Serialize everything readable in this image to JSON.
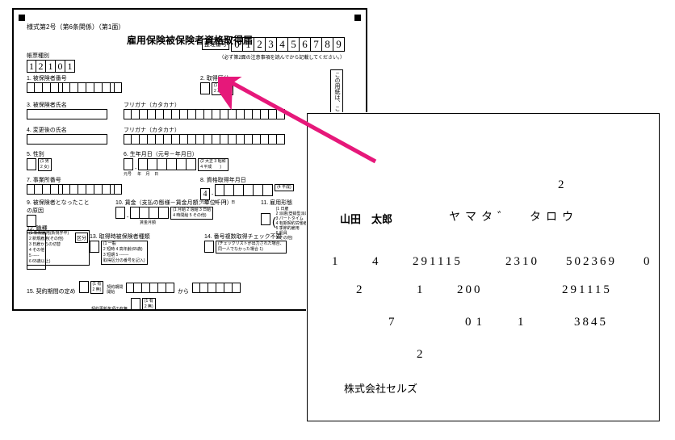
{
  "form": {
    "header": "様式第2号（第6条関係）（第1面）",
    "title": "雇用保険被保険者資格取得届",
    "seibango_label": "整理番号",
    "seibango_digits": [
      "0",
      "1",
      "2",
      "3",
      "4",
      "5",
      "6",
      "7",
      "8",
      "9"
    ],
    "note": "（必ず第2面の注意事項を読んでから記載してください。）",
    "chohyo_label": "帳票種別",
    "chohyo_value": [
      "1",
      "2",
      "1",
      "0",
      "1"
    ],
    "sec1": "1. 被保険者番号",
    "sec2": "2. 取得区分",
    "sec2_legend": "(1 新規\n2 再取得)",
    "sec3": "3. 被保険者氏名",
    "furigana": "フリガナ（カタカナ）",
    "sec4": "4. 変更後の氏名",
    "sec5": "5. 性別",
    "sec5_legend": "(1 男\n2 女)",
    "sec6": "6. 生年月日（元号－年月日）",
    "sec6_legend": "(2 大正 3 昭和\n4 平成　　)",
    "sec6_sub1": "元号",
    "sec6_sub2": "年",
    "sec6_sub3": "月",
    "sec6_sub4": "日",
    "sec7": "7. 事業所番号",
    "sec8": "8. 資格取得年月日",
    "sec8_legend": "(4 平成)",
    "sec9": "9. 被保険者となったこと\nの原因",
    "sec9_legend": "(1 新規雇用(新規学卒)\n2 新規雇用(その他)\n3 日雇からの切替\n4 その他\n5 -----\n6 65歳以上)",
    "sec10": "10. 賃金（支払の態様－賃金月額：単位千円）",
    "sec10_legend": "(1 月給 2 週給 3 日給\n4 時間給 5 その他)",
    "sec10_sub": "賃金月額",
    "sec11": "11. 雇用形態",
    "sec11_legend": "(1 日雇\n2 派遣(登録型派遣)\n3 パートタイム\n4 有期契約労働者\n5 季節的雇用\n6 船員\n7 その他)",
    "sec12": "12. 職種",
    "sec13": "13. 取得時被保険者種類",
    "sec13_box": "区分",
    "sec13_legend": "(1 一般\n2 短時 4 高年齢(65歳)\n3 短期 5 -------\n取得区分の番号を記入)",
    "sec14": "14. 番号複数取得チェック不要",
    "sec14_legend": "(チェックリストが出力された場合、\n同一人でなかった場合 1)",
    "sec15": "15. 契約期間の定め",
    "sec15_legend": "(1 有\n2 無)",
    "sec15b": "契約期間\n開始",
    "sec15_kara": "から",
    "sec15c": "契約更新条項の有無",
    "sec15c_legend": "(1 有\n2 無)",
    "vnote": "この用紙は、このまま機械"
  },
  "paper": {
    "val_top": "2",
    "name": "山田　太郎",
    "kana": "ヤマタ゛　タロウ",
    "r1a": "1",
    "r1b": "4",
    "r1c": "291115",
    "r1d": "2310",
    "r1e": "502369",
    "r1f": "0",
    "r2a": "2",
    "r2b": "1",
    "r2c": "200",
    "r2d": "291115",
    "r3a": "7",
    "r3b": "01",
    "r3c": "1",
    "r3d": "3845",
    "r4a": "2",
    "company": "株式会社セルズ"
  }
}
